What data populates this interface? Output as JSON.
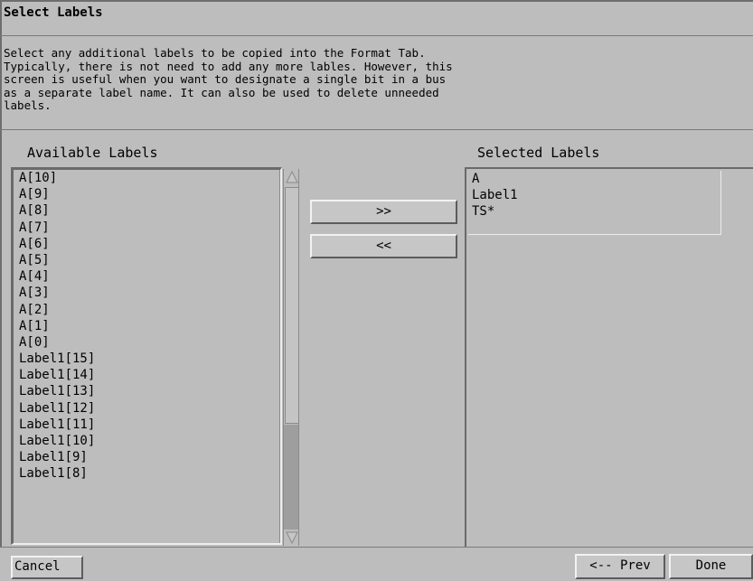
{
  "dialog": {
    "title": "Select Labels",
    "description": "Select any additional labels to be copied into the Format Tab.\nTypically, there is not need to add any more lables. However, this\nscreen is useful when you want to designate a single bit in a bus\nas a separate label name. It can also be used to delete unneeded\nlabels."
  },
  "available": {
    "heading": "Available Labels",
    "items": [
      "A[10]",
      "A[9]",
      "A[8]",
      "A[7]",
      "A[6]",
      "A[5]",
      "A[4]",
      "A[3]",
      "A[2]",
      "A[1]",
      "A[0]",
      "Label1[15]",
      "Label1[14]",
      "Label1[13]",
      "Label1[12]",
      "Label1[11]",
      "Label1[10]",
      "Label1[9]",
      "Label1[8]"
    ]
  },
  "selected": {
    "heading": "Selected Labels",
    "items": [
      "A",
      "Label1",
      "TS*"
    ]
  },
  "buttons": {
    "add": ">>",
    "remove": "<<",
    "cancel": "Cancel",
    "prev": "<-- Prev",
    "done": "Done"
  },
  "icons": {
    "scroll_up": "scroll-up-arrow-icon",
    "scroll_down": "scroll-down-arrow-icon"
  }
}
